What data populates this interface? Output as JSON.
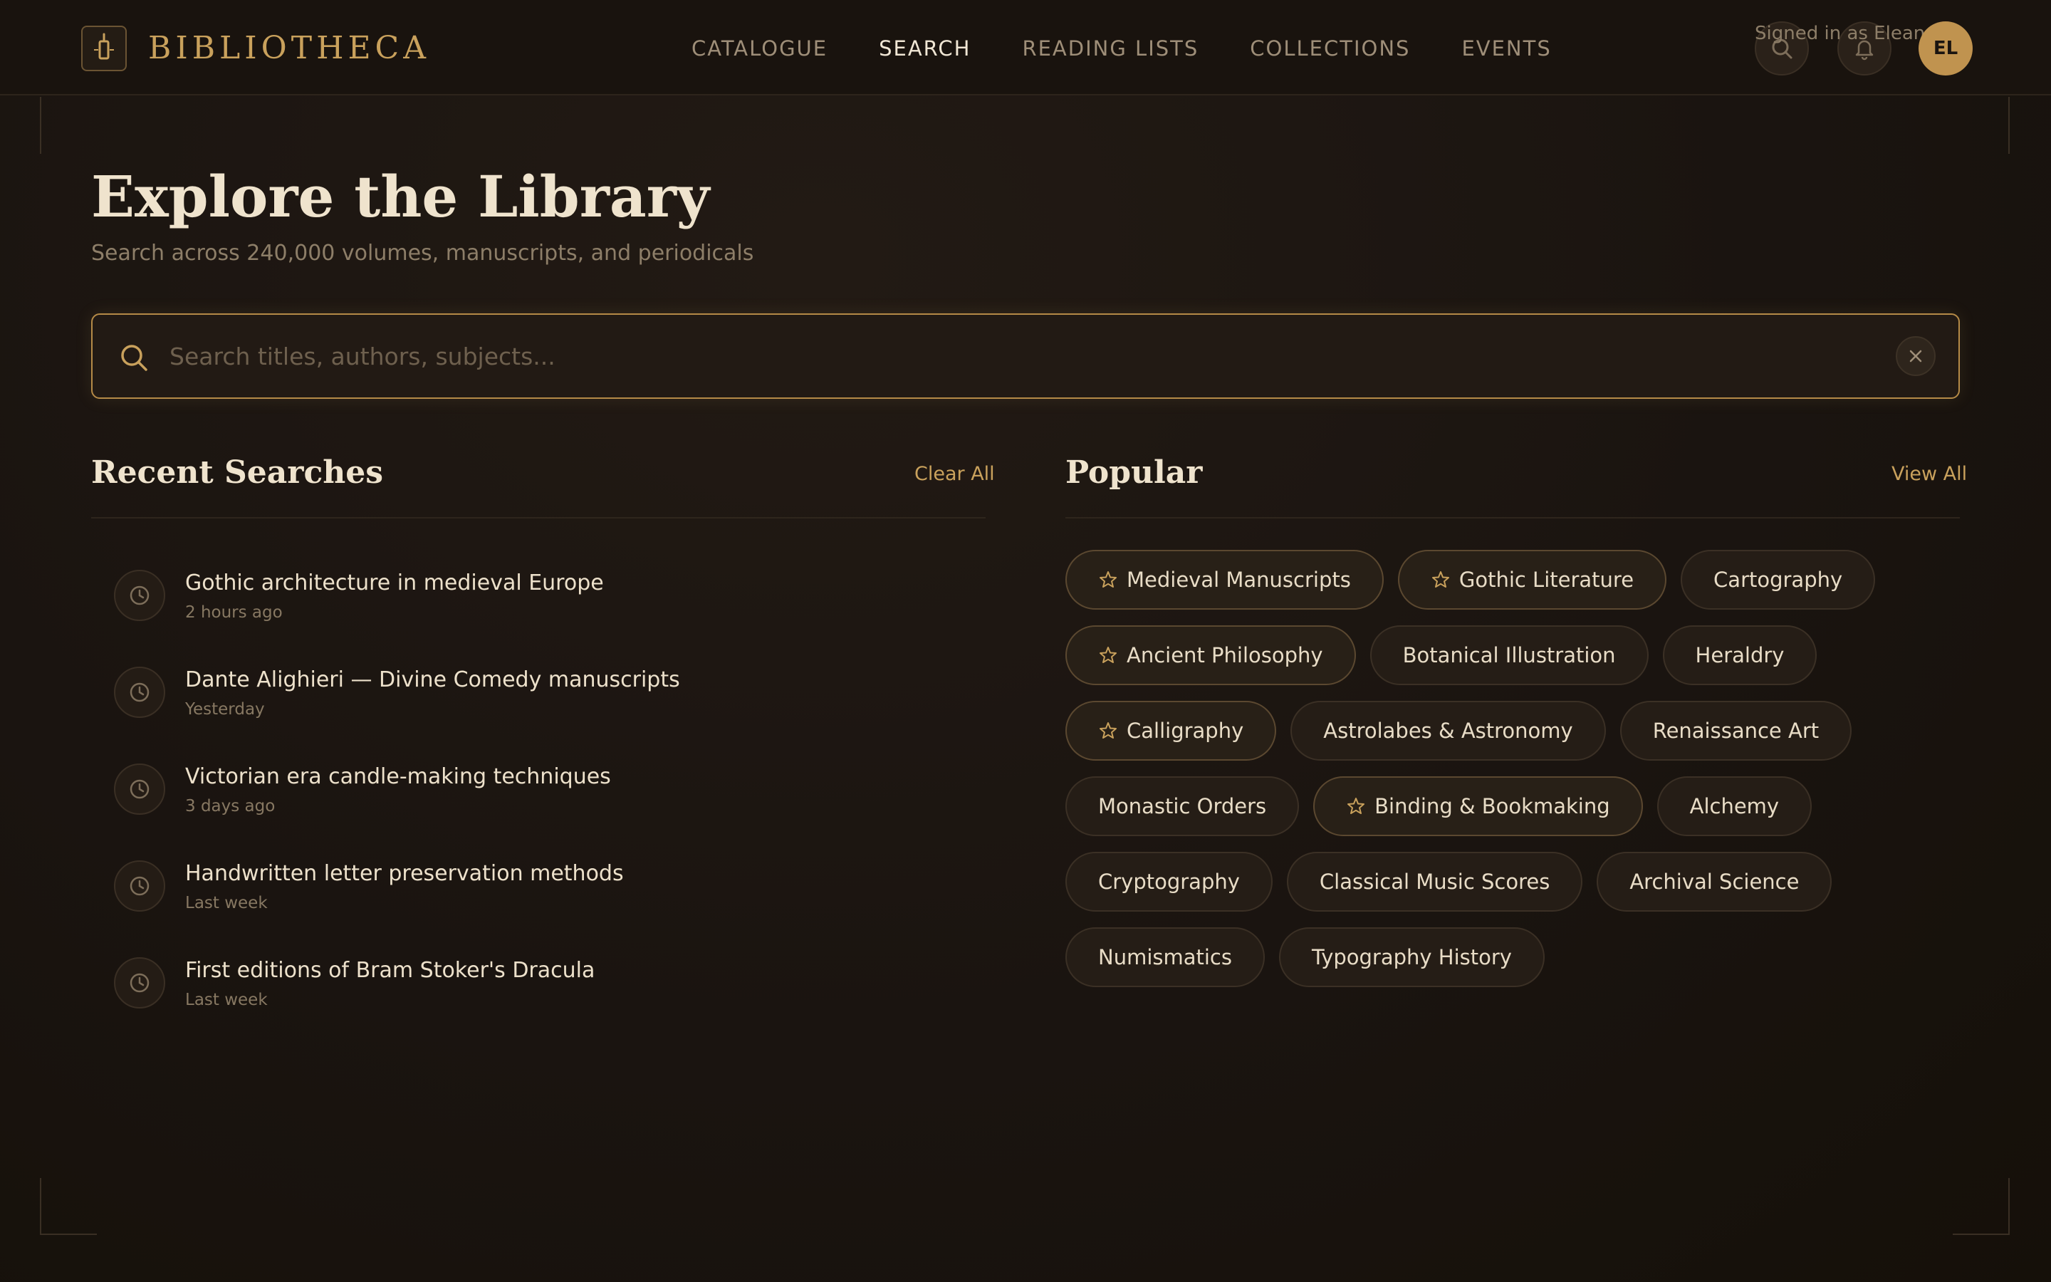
{
  "header": {
    "logo_text": "BIBLIOTHECA",
    "nav": [
      {
        "label": "CATALOGUE",
        "active": false
      },
      {
        "label": "SEARCH",
        "active": true
      },
      {
        "label": "READING LISTS",
        "active": false
      },
      {
        "label": "COLLECTIONS",
        "active": false
      },
      {
        "label": "EVENTS",
        "active": false
      }
    ],
    "signed_in": "Signed in as Eleanor",
    "avatar_initials": "EL"
  },
  "page": {
    "title": "Explore the Library",
    "subtitle": "Search across 240,000 volumes, manuscripts, and periodicals"
  },
  "search": {
    "placeholder": "Search titles, authors, subjects...",
    "value": ""
  },
  "recent": {
    "title": "Recent Searches",
    "action": "Clear All",
    "items": [
      {
        "query": "Gothic architecture in medieval Europe",
        "time": "2 hours ago"
      },
      {
        "query": "Dante Alighieri — Divine Comedy manuscripts",
        "time": "Yesterday"
      },
      {
        "query": "Victorian era candle-making techniques",
        "time": "3 days ago"
      },
      {
        "query": "Handwritten letter preservation methods",
        "time": "Last week"
      },
      {
        "query": "First editions of Bram Stoker's Dracula",
        "time": "Last week"
      }
    ]
  },
  "popular": {
    "title": "Popular",
    "action": "View All",
    "tags": [
      {
        "label": "Medieval Manuscripts",
        "starred": true
      },
      {
        "label": "Gothic Literature",
        "starred": true
      },
      {
        "label": "Cartography",
        "starred": false
      },
      {
        "label": "Ancient Philosophy",
        "starred": true
      },
      {
        "label": "Botanical Illustration",
        "starred": false
      },
      {
        "label": "Heraldry",
        "starred": false
      },
      {
        "label": "Calligraphy",
        "starred": true
      },
      {
        "label": "Astrolabes & Astronomy",
        "starred": false
      },
      {
        "label": "Renaissance Art",
        "starred": false
      },
      {
        "label": "Monastic Orders",
        "starred": false
      },
      {
        "label": "Binding & Bookmaking",
        "starred": true
      },
      {
        "label": "Alchemy",
        "starred": false
      },
      {
        "label": "Cryptography",
        "starred": false
      },
      {
        "label": "Classical Music Scores",
        "starred": false
      },
      {
        "label": "Archival Science",
        "starred": false
      },
      {
        "label": "Numismatics",
        "starred": false
      },
      {
        "label": "Typography History",
        "starred": false
      }
    ]
  },
  "colors": {
    "accent": "#c9a15c",
    "background": "#1a1410",
    "text": "#e8dcc6",
    "muted": "#8d7e68"
  },
  "icons": {
    "logo": "candle-icon",
    "search": "search-icon",
    "notifications": "bell-icon",
    "clear": "close-icon",
    "recent": "clock-icon",
    "starred": "star-icon"
  }
}
